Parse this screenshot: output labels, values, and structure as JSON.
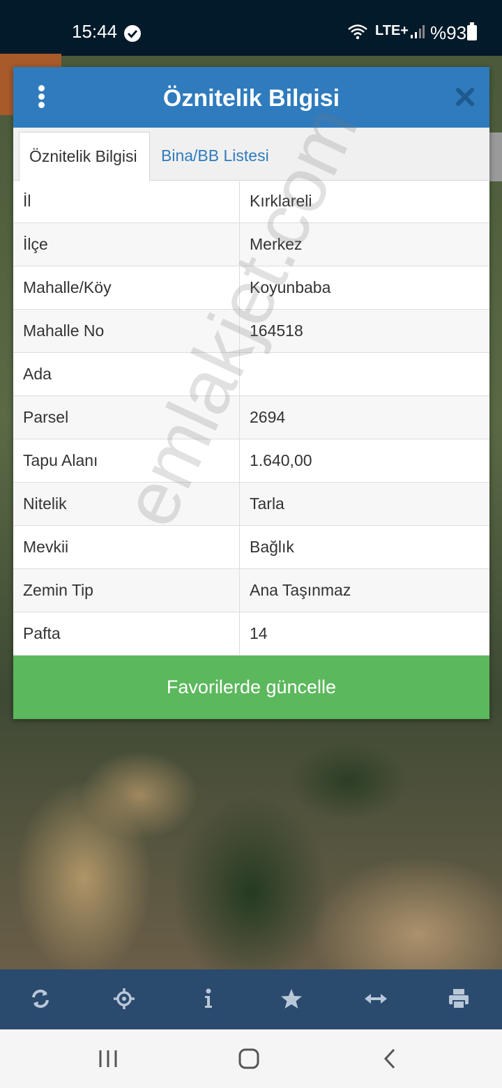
{
  "status_bar": {
    "time": "15:44",
    "network_label": "LTE+",
    "battery": "%93"
  },
  "dialog": {
    "title": "Öznitelik Bilgisi",
    "tabs": [
      {
        "label": "Öznitelik Bilgisi",
        "active": true
      },
      {
        "label": "Bina/BB Listesi",
        "active": false
      }
    ],
    "rows": [
      {
        "key": "İl",
        "value": "Kırklareli"
      },
      {
        "key": "İlçe",
        "value": "Merkez"
      },
      {
        "key": "Mahalle/Köy",
        "value": "Koyunbaba"
      },
      {
        "key": "Mahalle No",
        "value": "164518"
      },
      {
        "key": "Ada",
        "value": ""
      },
      {
        "key": "Parsel",
        "value": "2694"
      },
      {
        "key": "Tapu Alanı",
        "value": "1.640,00"
      },
      {
        "key": "Nitelik",
        "value": "Tarla"
      },
      {
        "key": "Mevkii",
        "value": "Bağlık"
      },
      {
        "key": "Zemin Tip",
        "value": "Ana Taşınmaz"
      },
      {
        "key": "Pafta",
        "value": "14"
      }
    ],
    "favorite_button": "Favorilerde güncelle"
  },
  "watermark": "emlakjet.com",
  "toolbar": {
    "icons": [
      "refresh-icon",
      "crosshair-icon",
      "info-icon",
      "star-icon",
      "measure-icon",
      "print-icon"
    ]
  },
  "colors": {
    "header": "#2f7bbd",
    "button_green": "#5cb85c",
    "toolbar": "#2a4a6e"
  }
}
